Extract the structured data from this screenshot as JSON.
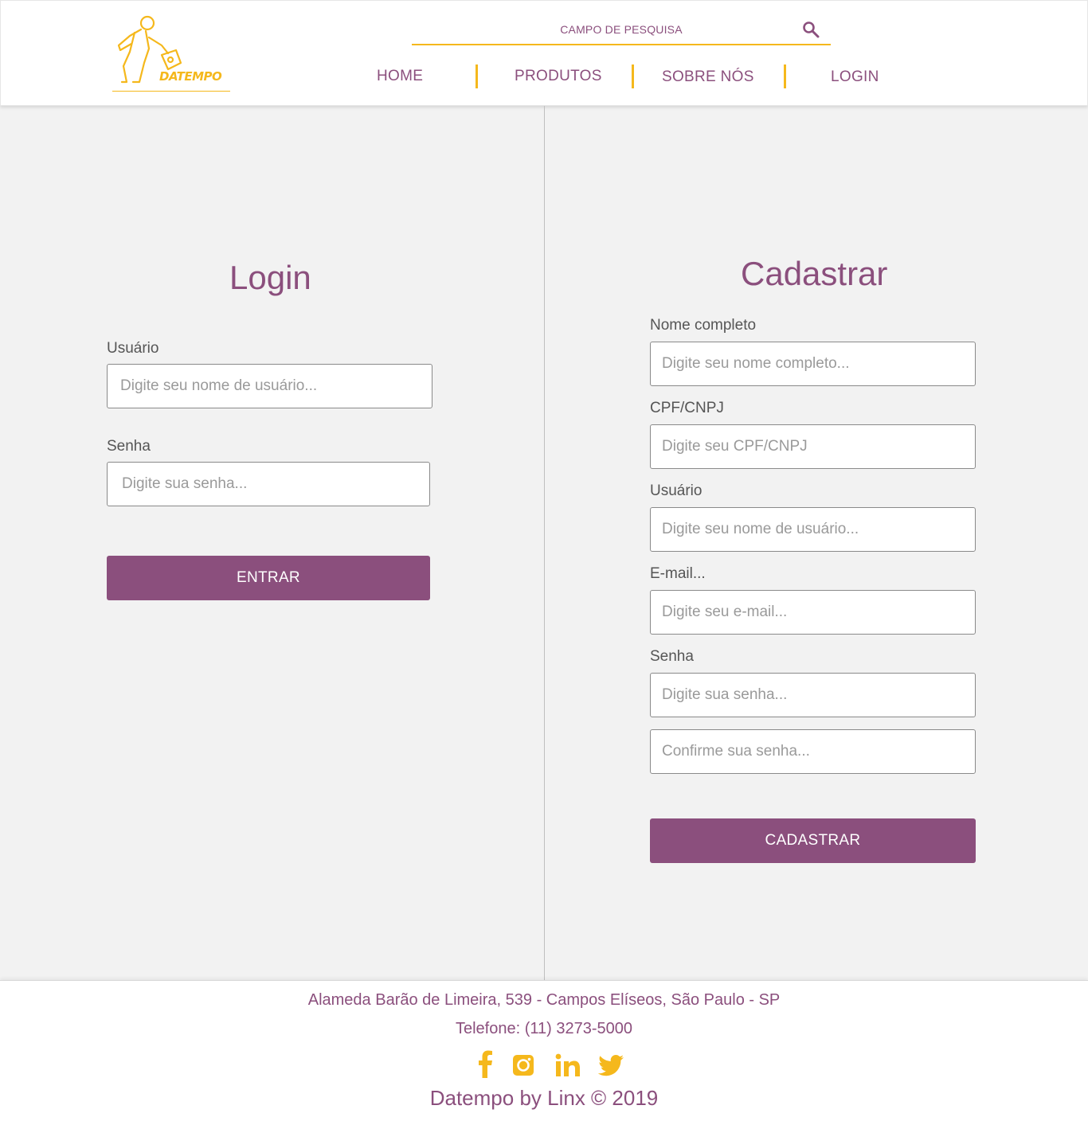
{
  "brand": {
    "name": "DATEMPO",
    "accent": "#f5b81c",
    "primary": "#8b4f7d"
  },
  "header": {
    "search": {
      "placeholder": "CAMPO DE PESQUISA",
      "icon": "search-icon"
    },
    "nav": [
      {
        "label": "HOME"
      },
      {
        "label": "PRODUTOS"
      },
      {
        "label": "SOBRE NÓS"
      },
      {
        "label": "LOGIN"
      }
    ]
  },
  "login": {
    "title": "Login",
    "username_label": "Usuário",
    "username_placeholder": "Digite seu nome de usuário...",
    "password_label": "Senha",
    "password_placeholder": "Digite sua senha...",
    "submit_label": "ENTRAR"
  },
  "register": {
    "title": "Cadastrar",
    "fullname_label": "Nome completo",
    "fullname_placeholder": "Digite seu nome completo...",
    "doc_label": "CPF/CNPJ",
    "doc_placeholder": "Digite seu CPF/CNPJ",
    "username_label": "Usuário",
    "username_placeholder": "Digite seu nome de usuário...",
    "email_label": "E-mail...",
    "email_placeholder": "Digite seu e-mail...",
    "password_label": "Senha",
    "password_placeholder": "Digite sua senha...",
    "confirm_placeholder": "Confirme sua senha...",
    "submit_label": "CADASTRAR"
  },
  "footer": {
    "address": "Alameda Barão de Limeira, 539 - Campos Elíseos, São Paulo - SP",
    "phone": "Telefone: (11) 3273-5000",
    "social": [
      "facebook-icon",
      "instagram-icon",
      "linkedin-icon",
      "twitter-icon"
    ],
    "copyright": "Datempo by Linx © 2019"
  }
}
